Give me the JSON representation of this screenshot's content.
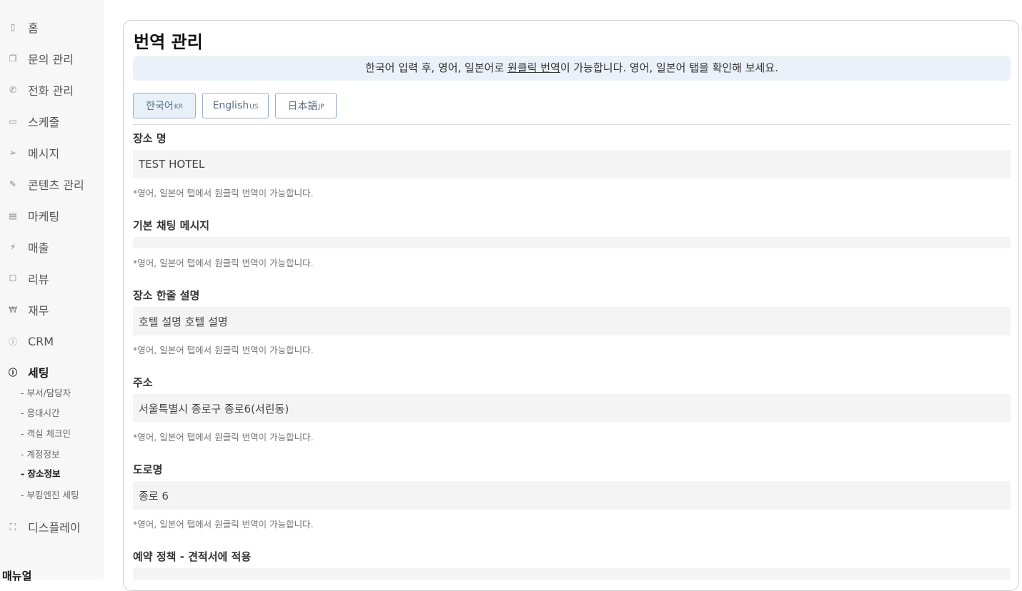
{
  "sidebar": {
    "items": [
      {
        "label": "홈",
        "icon": "home-icon",
        "glyph": "▯"
      },
      {
        "label": "문의 관리",
        "icon": "inquiry-icon",
        "glyph": "❐"
      },
      {
        "label": "전화 관리",
        "icon": "phone-icon",
        "glyph": "✆"
      },
      {
        "label": "스케줄",
        "icon": "calendar-icon",
        "glyph": "▭"
      },
      {
        "label": "메시지",
        "icon": "send-icon",
        "glyph": "➢"
      },
      {
        "label": "콘텐츠 관리",
        "icon": "edit-icon",
        "glyph": "✎"
      },
      {
        "label": "마케팅",
        "icon": "marketing-icon",
        "glyph": "▤"
      },
      {
        "label": "매출",
        "icon": "sales-icon",
        "glyph": "⚡"
      },
      {
        "label": "리뷰",
        "icon": "chat-icon",
        "glyph": "☐"
      },
      {
        "label": "재무",
        "icon": "won-icon",
        "glyph": "₩"
      },
      {
        "label": "CRM",
        "icon": "info-icon",
        "glyph": "ⓘ"
      },
      {
        "label": "세팅",
        "icon": "settings-info-icon",
        "glyph": "ⓘ"
      }
    ],
    "sub_items": [
      "- 부서/담당자",
      "- 응대시간",
      "- 객실 체크인",
      "- 계정정보",
      "- 장소정보",
      "- 부킹엔진 세팅"
    ],
    "display": {
      "label": "디스플레이",
      "icon": "fullscreen-icon",
      "glyph": "⛶"
    },
    "menu_lang": "매뉴얼"
  },
  "main": {
    "title": "번역 관리",
    "notice": {
      "before": "한국어 입력 후, 영어, 일본어로 ",
      "link": "원클릭 번역",
      "after": "이 가능합니다. 영어, 일본어 탭을 확인해 보세요."
    },
    "tabs": [
      {
        "label": "한국어",
        "code": "KR"
      },
      {
        "label": "English",
        "code": "US"
      },
      {
        "label": "日本語",
        "code": "JP"
      }
    ],
    "fields": [
      {
        "label": "장소 명",
        "value": "TEST HOTEL",
        "hint": "*영어, 일본어 탭에서 원클릭 번역이 가능합니다."
      },
      {
        "label": "기본 채팅 메시지",
        "value": "",
        "hint": "*영어, 일본어 탭에서 원클릭 번역이 가능합니다."
      },
      {
        "label": "장소 한줄 설명",
        "value": "호텔 설명 호텔 설명",
        "hint": "*영어, 일본어 탭에서 원클릭 번역이 가능합니다."
      },
      {
        "label": "주소",
        "value": "서울특별시 종로구 종로6(서린동)",
        "hint": "*영어, 일본어 탭에서 원클릭 번역이 가능합니다."
      },
      {
        "label": "도로명",
        "value": "종로 6",
        "hint": "*영어, 일본어 탭에서 원클릭 번역이 가능합니다."
      },
      {
        "label": "예약 정책 - 견적서에 적용",
        "value": "",
        "hint": ""
      }
    ]
  }
}
